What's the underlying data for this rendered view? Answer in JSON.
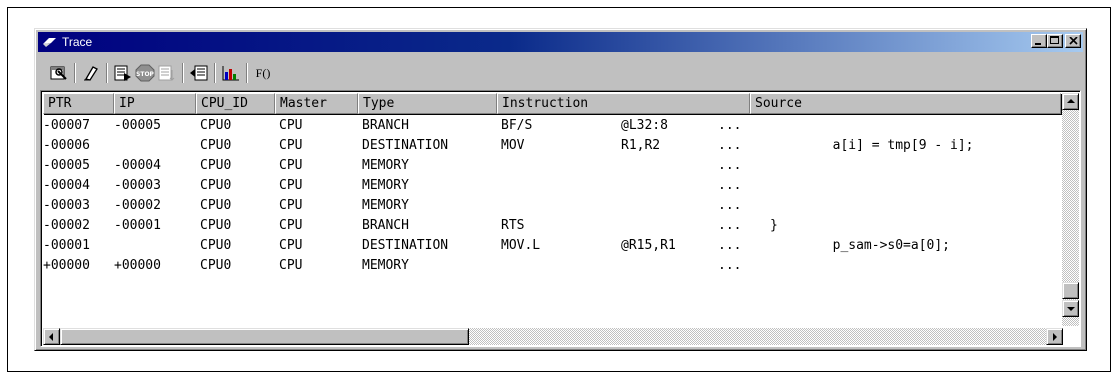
{
  "window": {
    "title": "Trace"
  },
  "toolbar": {
    "buttons": [
      {
        "name": "properties-icon"
      },
      {
        "name": "eraser-icon"
      },
      {
        "name": "trace-start-icon"
      },
      {
        "name": "stop-icon",
        "label": "STOP"
      },
      {
        "name": "trace-step-icon"
      },
      {
        "name": "trace-save-icon"
      },
      {
        "name": "statistics-chart-icon"
      },
      {
        "name": "function-icon",
        "label": "F()"
      }
    ]
  },
  "table": {
    "columns": [
      "PTR",
      "IP",
      "CPU_ID",
      "Master",
      "Type",
      "Instruction",
      "Source"
    ],
    "rows": [
      {
        "ptr": "-00007",
        "ip": "-00005",
        "cpu": "CPU0",
        "master": "CPU",
        "type": "BRANCH",
        "mnemonic": "BF/S",
        "operand": "@L32:8",
        "more": "...",
        "source": ""
      },
      {
        "ptr": "-00006",
        "ip": "",
        "cpu": "CPU0",
        "master": "CPU",
        "type": "DESTINATION",
        "mnemonic": "MOV",
        "operand": "R1,R2",
        "more": "...",
        "source": "        a[i] = tmp[9 - i];"
      },
      {
        "ptr": "-00005",
        "ip": "-00004",
        "cpu": "CPU0",
        "master": "CPU",
        "type": "MEMORY",
        "mnemonic": "",
        "operand": "",
        "more": "...",
        "source": ""
      },
      {
        "ptr": "-00004",
        "ip": "-00003",
        "cpu": "CPU0",
        "master": "CPU",
        "type": "MEMORY",
        "mnemonic": "",
        "operand": "",
        "more": "...",
        "source": ""
      },
      {
        "ptr": "-00003",
        "ip": "-00002",
        "cpu": "CPU0",
        "master": "CPU",
        "type": "MEMORY",
        "mnemonic": "",
        "operand": "",
        "more": "...",
        "source": ""
      },
      {
        "ptr": "-00002",
        "ip": "-00001",
        "cpu": "CPU0",
        "master": "CPU",
        "type": "BRANCH",
        "mnemonic": "RTS",
        "operand": "",
        "more": "...",
        "source": "}"
      },
      {
        "ptr": "-00001",
        "ip": "",
        "cpu": "CPU0",
        "master": "CPU",
        "type": "DESTINATION",
        "mnemonic": "MOV.L",
        "operand": "@R15,R1",
        "more": "...",
        "source": "        p_sam->s0=a[0];"
      },
      {
        "ptr": "+00000",
        "ip": "+00000",
        "cpu": "CPU0",
        "master": "CPU",
        "type": "MEMORY",
        "mnemonic": "",
        "operand": "",
        "more": "...",
        "source": ""
      }
    ]
  },
  "colors": {
    "titlebar_start": "#000080",
    "titlebar_end": "#a6caf0",
    "face": "#c0c0c0"
  }
}
